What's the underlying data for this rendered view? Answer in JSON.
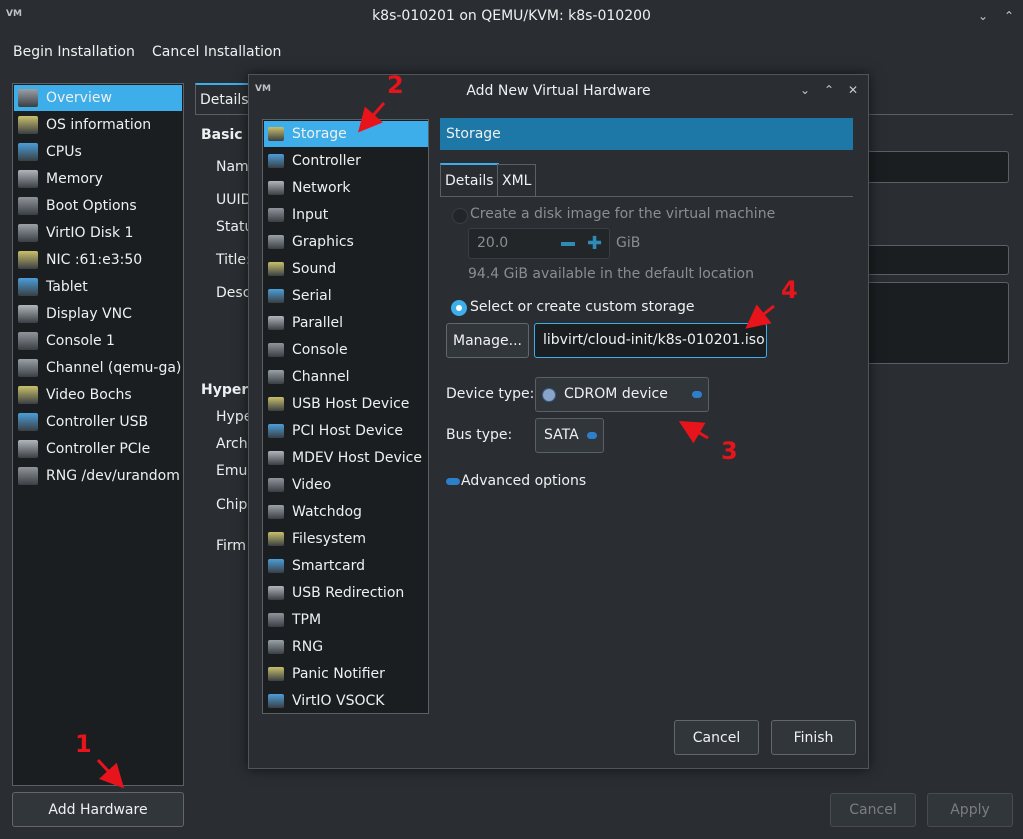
{
  "window": {
    "title": "k8s-010201 on QEMU/KVM: k8s-010200"
  },
  "menu": {
    "begin": "Begin Installation",
    "cancel": "Cancel Installation"
  },
  "sidebar": {
    "items": [
      {
        "label": "Overview"
      },
      {
        "label": "OS information"
      },
      {
        "label": "CPUs"
      },
      {
        "label": "Memory"
      },
      {
        "label": "Boot Options"
      },
      {
        "label": "VirtIO Disk 1"
      },
      {
        "label": "NIC :61:e3:50"
      },
      {
        "label": "Tablet"
      },
      {
        "label": "Display VNC"
      },
      {
        "label": "Console 1"
      },
      {
        "label": "Channel (qemu-ga)"
      },
      {
        "label": "Video Bochs"
      },
      {
        "label": "Controller USB"
      },
      {
        "label": "Controller PCIe"
      },
      {
        "label": "RNG /dev/urandom"
      }
    ],
    "add_hardware": "Add Hardware"
  },
  "main": {
    "tab_details": "Details",
    "basic_heading": "Basic D",
    "labels": [
      "Nam",
      "UUID",
      "Statu",
      "Title:",
      "Desc"
    ],
    "hyper_heading": "Hyperv",
    "hyper_labels": [
      "Hype",
      "Arch",
      "Emu",
      "Chip",
      "Firm"
    ],
    "cancel": "Cancel",
    "apply": "Apply"
  },
  "dialog": {
    "title": "Add New Virtual Hardware",
    "hardware": [
      {
        "label": "Storage"
      },
      {
        "label": "Controller"
      },
      {
        "label": "Network"
      },
      {
        "label": "Input"
      },
      {
        "label": "Graphics"
      },
      {
        "label": "Sound"
      },
      {
        "label": "Serial"
      },
      {
        "label": "Parallel"
      },
      {
        "label": "Console"
      },
      {
        "label": "Channel"
      },
      {
        "label": "USB Host Device"
      },
      {
        "label": "PCI Host Device"
      },
      {
        "label": "MDEV Host Device"
      },
      {
        "label": "Video"
      },
      {
        "label": "Watchdog"
      },
      {
        "label": "Filesystem"
      },
      {
        "label": "Smartcard"
      },
      {
        "label": "USB Redirection"
      },
      {
        "label": "TPM"
      },
      {
        "label": "RNG"
      },
      {
        "label": "Panic Notifier"
      },
      {
        "label": "VirtIO VSOCK"
      }
    ],
    "header": "Storage",
    "tabs": [
      "Details",
      "XML"
    ],
    "create_disk": "Create a disk image for the virtual machine",
    "size_value": "20.0",
    "size_unit": "GiB",
    "available": "94.4 GiB available in the default location",
    "custom_storage": "Select or create custom storage",
    "manage": "Manage...",
    "path_value": "libvirt/cloud-init/k8s-010201.iso",
    "device_type_label": "Device type:",
    "device_type_value": "CDROM device",
    "bus_type_label": "Bus type:",
    "bus_type_value": "SATA",
    "advanced": "Advanced options",
    "cancel": "Cancel",
    "finish": "Finish"
  },
  "annotations": [
    "1",
    "2",
    "3",
    "4"
  ],
  "colors": {
    "accent": "#3daee9",
    "header": "#1d78a8",
    "marker": "#e8141c"
  }
}
